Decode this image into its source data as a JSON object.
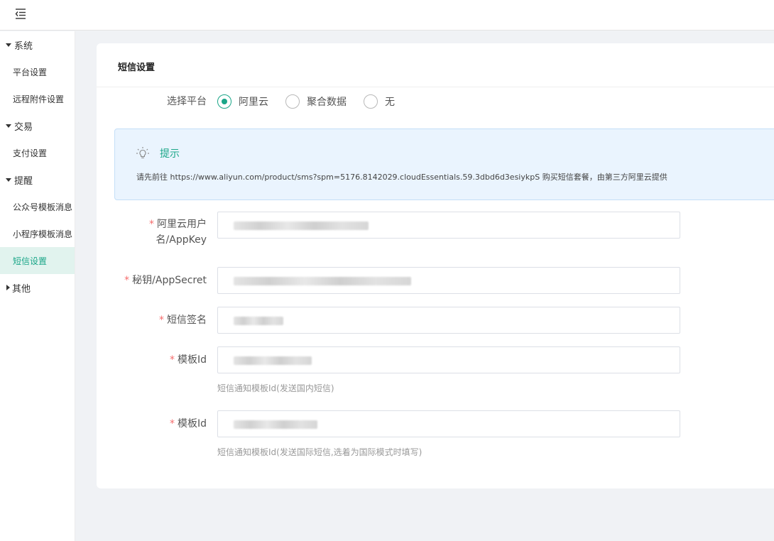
{
  "sidebar": {
    "groups": [
      {
        "label": "系统",
        "items": [
          "平台设置",
          "远程附件设置"
        ]
      },
      {
        "label": "交易",
        "items": [
          "支付设置"
        ]
      },
      {
        "label": "提醒",
        "items": [
          "公众号模板消息",
          "小程序模板消息",
          "短信设置"
        ]
      },
      {
        "label": "其他",
        "items": []
      }
    ],
    "active_item": "短信设置"
  },
  "card": {
    "title": "短信设置",
    "platform": {
      "label": "选择平台",
      "options": [
        "阿里云",
        "聚合数据",
        "无"
      ],
      "selected": "阿里云"
    },
    "tip": {
      "title": "提示",
      "text": "请先前往 https://www.aliyun.com/product/sms?spm=5176.8142029.cloudEssentials.59.3dbd6d3esiykpS 购买短信套餐，由第三方阿里云提供"
    },
    "fields": {
      "appkey_label": "阿里云用户名/AppKey",
      "appsecret_label": "秘钥/AppSecret",
      "sign_label": "短信签名",
      "template_label": "模板Id",
      "template_help": "短信通知模板Id(发送国内短信)",
      "intl_template_label": "模板Id",
      "intl_template_help": "短信通知模板Id(发送国际短信,选着为国际模式时填写)"
    },
    "required_mark": "*"
  },
  "colors": {
    "accent": "#1aa688",
    "active_bg": "#e1f3ee",
    "required": "#f56c6c",
    "tip_bg": "#eaf4fe"
  },
  "icons": {
    "menu_toggle": "menu-fold-icon",
    "tip": "lightbulb-icon"
  }
}
